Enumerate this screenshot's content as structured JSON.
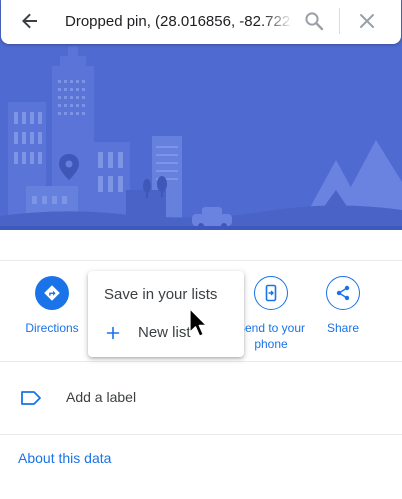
{
  "search": {
    "value": "Dropped pin, (28.016856, -82.7228",
    "back_icon": "arrow-back-icon",
    "search_icon": "magnifier-icon",
    "close_icon": "close-x-icon"
  },
  "hero": {
    "illustration": "city-skyline-with-location-pin",
    "background_color": "#4f6bd1"
  },
  "actions": [
    {
      "label": "Directions",
      "icon": "directions-turn-icon"
    },
    {
      "label": "Send to your\nphone",
      "icon": "phone-send-icon"
    },
    {
      "label": "Share",
      "icon": "share-icon"
    }
  ],
  "save_popup": {
    "title": "Save in your lists",
    "new_list_label": "New list",
    "plus_icon": "plus-icon"
  },
  "label_row": {
    "text": "Add a label",
    "icon": "label-tag-icon"
  },
  "about_link": "About this data",
  "colors": {
    "accent": "#1a73e8",
    "text": "#3c4043",
    "divider": "#e8eaed"
  }
}
